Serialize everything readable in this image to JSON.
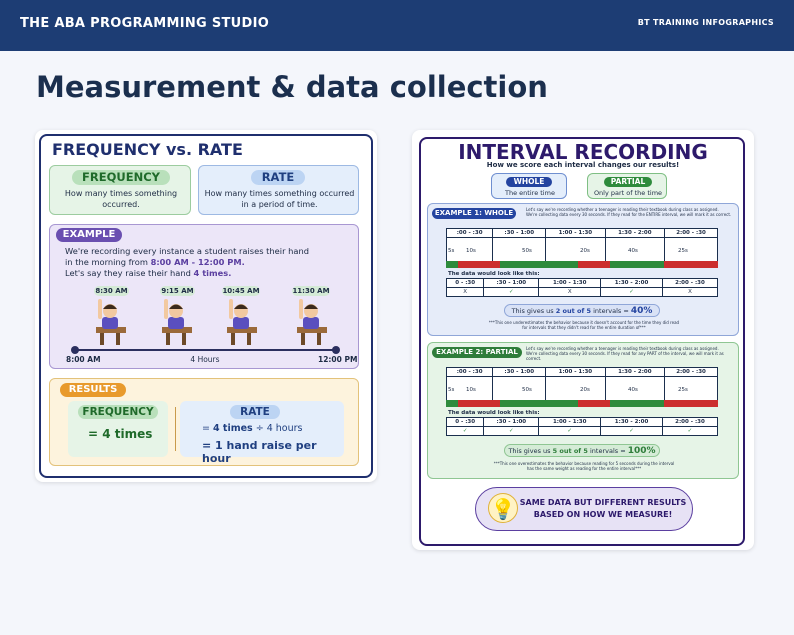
{
  "header": {
    "brand": "THE ABA PROGRAMMING STUDIO",
    "tag": "BT TRAINING INFOGRAPHICS"
  },
  "title": "Measurement & data collection",
  "freq_rate": {
    "title": "FREQUENCY vs. RATE",
    "frequency": {
      "label": "FREQUENCY",
      "desc_l1": "How many times something",
      "desc_l2": "occurred."
    },
    "rate": {
      "label": "RATE",
      "desc_l1": "How many times something occurred",
      "desc_l2": "in a period of time."
    },
    "example": {
      "label": "EXAMPLE",
      "l1": "We're recording every instance a student raises their hand",
      "l2a": "in the morning from ",
      "l2b": "8:00 AM - 12:00 PM.",
      "l3a": "Let's say they raise their hand ",
      "l3b": "4 times."
    },
    "times": [
      "8:30 AM",
      "9:15 AM",
      "10:45 AM",
      "11:30 AM"
    ],
    "timeline": {
      "start": "8:00 AM",
      "mid": "4 Hours",
      "end": "12:00 PM"
    },
    "results": {
      "label": "RESULTS",
      "freq_label": "FREQUENCY",
      "freq_value": "= 4 times",
      "rate_label": "RATE",
      "rate_l1a": "= ",
      "rate_l1b": "4 times",
      "rate_l1c": "  ÷  4 hours",
      "rate_l2": "= 1 hand raise per hour"
    }
  },
  "interval": {
    "title": "INTERVAL RECORDING",
    "subtitle": "How we score each interval changes our results!",
    "whole": {
      "label": "WHOLE",
      "desc": "The entire time"
    },
    "partial": {
      "label": "PARTIAL",
      "desc": "Only part of the time"
    },
    "intervals": [
      ":00 - :30",
      ":30 - 1:00",
      "1:00 - 1:30",
      "1:30 - 2:00",
      "2:00 - :30"
    ],
    "intervals2": [
      "0 - :30",
      ":30 - 1:00",
      "1:00 - 1:30",
      "1:30 - 2:00",
      "2:00 - :30"
    ],
    "durations": [
      "5s",
      "10s",
      "50s",
      "20s",
      "40s",
      "25s"
    ],
    "ex1": {
      "label": "EXAMPLE 1: WHOLE",
      "desc_l1": "Let's say we're recording whether a teenager is reading their textbook during class as assigned.",
      "desc_l2": "We're collecting data every 30 seconds. If they read for the ENTIRE interval, we will mark it as correct.",
      "data_label": "The data would look like this:",
      "marks": [
        "X",
        "✓",
        "X",
        "✓",
        "X"
      ],
      "result_a": "This gives us ",
      "result_b": "2 out of 5",
      "result_c": " intervals = ",
      "result_d": "40%",
      "note_l1": "***This one underestimates the behavior because it doesn't account for the time they did read",
      "note_l2": "for intervals that they didn't read for the entire duration of***"
    },
    "ex2": {
      "label": "EXAMPLE 2: PARTIAL",
      "desc_l1": "Let's say we're recording whether a teenager is reading their textbook during class as assigned.",
      "desc_l2": "We're collecting data every 30 seconds. If they read for any PART of the interval, we will mark it as correct.",
      "data_label": "The data would look like this:",
      "marks": [
        "✓",
        "✓",
        "✓",
        "✓",
        "✓"
      ],
      "result_a": "This gives us ",
      "result_b": "5 out of 5",
      "result_c": " intervals = ",
      "result_d": "100%",
      "note_l1": "***This one overestimates the behavior because reading for 5 seconds during the interval",
      "note_l2": "has the same weight as reading for the entire interval***"
    },
    "footer_l1": "SAME DATA BUT DIFFERENT RESULTS",
    "footer_l2": "BASED ON HOW WE MEASURE!"
  },
  "colors": {
    "navy": "#1d3d74",
    "green": "#2e8b3c",
    "red": "#cc2e2e",
    "purple": "#5b3fa0",
    "orange": "#e89a2c"
  }
}
